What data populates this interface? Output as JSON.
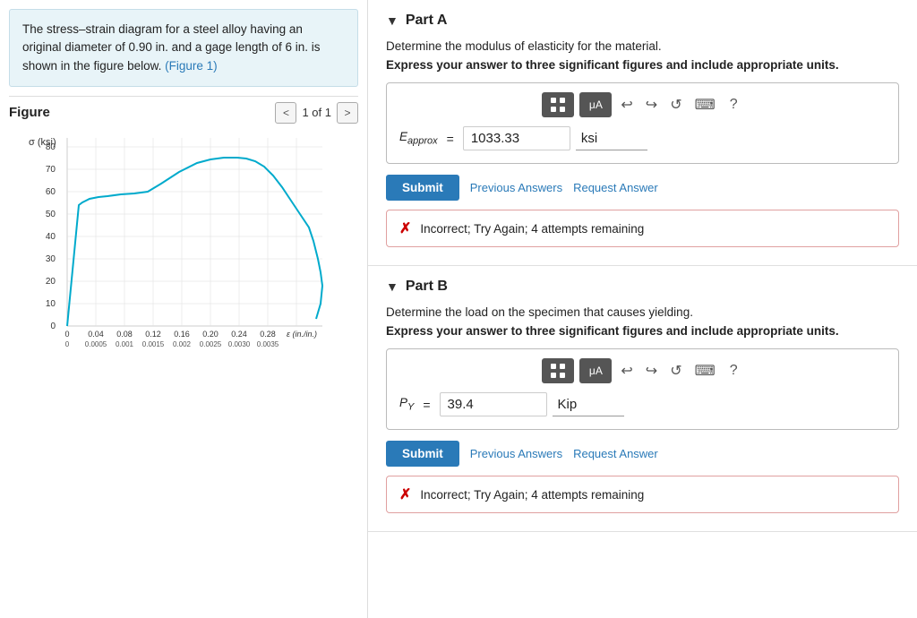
{
  "left": {
    "problem_text": "The stress–strain diagram for a steel alloy having an original diameter of 0.90 in. and a gage length of 6 in. is shown in the figure below.",
    "figure_link_text": "(Figure 1)",
    "figure_title": "Figure",
    "figure_nav": "1 of 1"
  },
  "right": {
    "part_a": {
      "title": "Part A",
      "question": "Determine the modulus of elasticity for the material.",
      "express": "Express your answer to three significant figures and include appropriate units.",
      "var_label": "E",
      "var_sub": "approx",
      "answer_value": "1033.33",
      "unit_value": "ksi",
      "submit_label": "Submit",
      "prev_answers_label": "Previous Answers",
      "request_answer_label": "Request Answer",
      "feedback": "Incorrect; Try Again; 4 attempts remaining",
      "toolbar": {
        "matrix_label": "⊞",
        "mu_label": "μA",
        "undo_label": "↩",
        "redo_label": "↪",
        "reset_label": "↺",
        "keyboard_label": "⌨",
        "help_label": "?"
      }
    },
    "part_b": {
      "title": "Part B",
      "question": "Determine the load on the specimen that causes yielding.",
      "express": "Express your answer to three significant figures and include appropriate units.",
      "var_label": "P",
      "var_sub": "Y",
      "answer_value": "39.4",
      "unit_value": "Kip",
      "submit_label": "Submit",
      "prev_answers_label": "Previous Answers",
      "request_answer_label": "Request Answer",
      "feedback": "Incorrect; Try Again; 4 attempts remaining",
      "toolbar": {
        "matrix_label": "⊞",
        "mu_label": "μA",
        "undo_label": "↩",
        "redo_label": "↪",
        "reset_label": "↺",
        "keyboard_label": "⌨",
        "help_label": "?"
      }
    }
  }
}
